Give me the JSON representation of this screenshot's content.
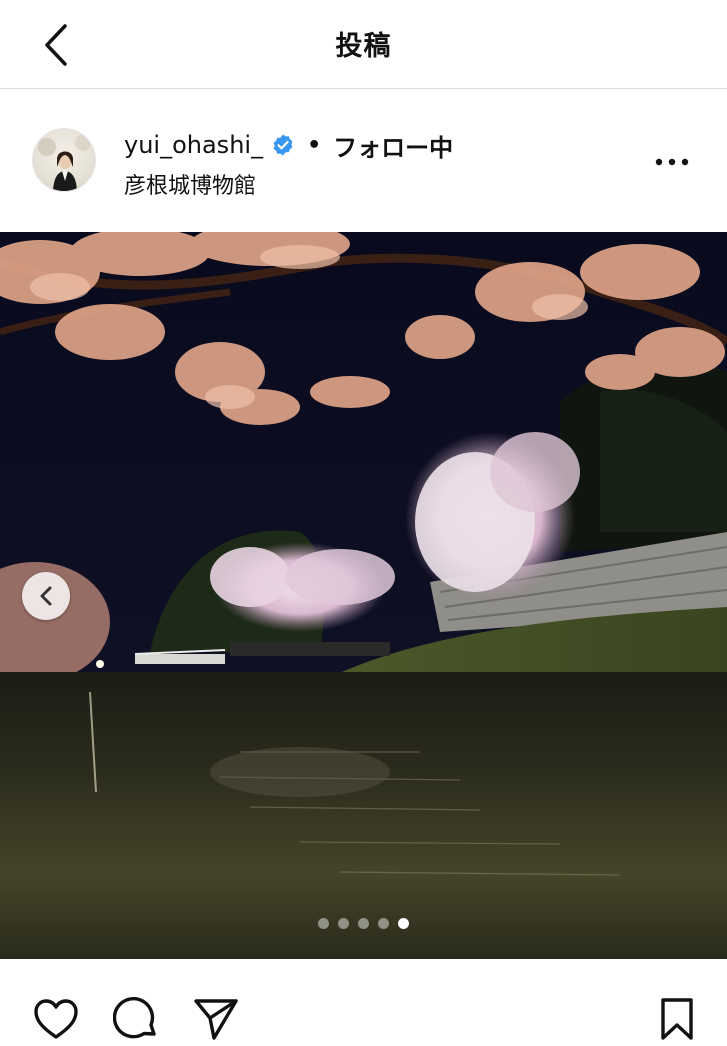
{
  "topbar": {
    "title": "投稿",
    "back_icon": "chevron-left-icon"
  },
  "post": {
    "username": "yui_ohashi_",
    "verified_color": "#3897f0",
    "separator": "•",
    "follow_status": "フォロー中",
    "location": "彦根城博物館",
    "more_icon": "more-horizontal-icon"
  },
  "carousel": {
    "total": 5,
    "active_index": 5,
    "prev_icon": "chevron-left-icon"
  },
  "actions": {
    "like_icon": "heart-icon",
    "comment_icon": "comment-icon",
    "share_icon": "send-icon",
    "save_icon": "bookmark-icon"
  }
}
